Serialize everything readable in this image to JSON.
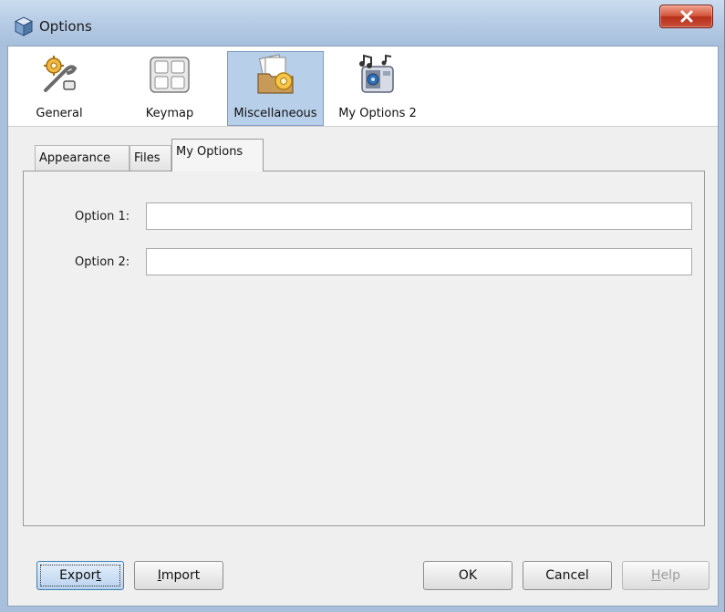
{
  "window": {
    "title": "Options",
    "close_icon": "close-x-icon",
    "title_icon": "cube-app-icon"
  },
  "categories": [
    {
      "label": "General",
      "icon": "gear-wrench-icon",
      "selected": false
    },
    {
      "label": "Keymap",
      "icon": "keyboard-icon",
      "selected": false
    },
    {
      "label": "Miscellaneous",
      "icon": "folder-gear-icon",
      "selected": true
    },
    {
      "label": "My Options 2",
      "icon": "music-media-icon",
      "selected": false
    }
  ],
  "tabs": [
    {
      "label": "Appearance",
      "active": false
    },
    {
      "label": "Files",
      "active": false
    },
    {
      "label": "My Options",
      "active": true
    }
  ],
  "fields": [
    {
      "label": "Option 1:",
      "value": ""
    },
    {
      "label": "Option 2:",
      "value": ""
    }
  ],
  "buttons": {
    "export": {
      "pre": "Expor",
      "mnemonic": "t",
      "post": ""
    },
    "import": {
      "pre": "",
      "mnemonic": "I",
      "post": "mport"
    },
    "ok": "OK",
    "cancel": "Cancel",
    "help": {
      "pre": "",
      "mnemonic": "H",
      "post": "elp",
      "enabled": false
    }
  },
  "colors": {
    "title_bar": "#b8cde6",
    "close_button": "#c9503a",
    "selected_category": "#b8cfe9"
  }
}
